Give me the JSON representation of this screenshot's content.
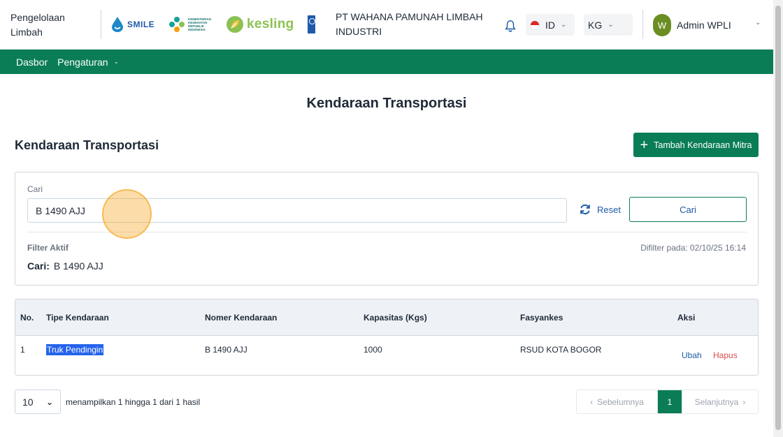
{
  "header": {
    "app_name": "Pengelolaan Limbah",
    "logos": {
      "smile": "SMILE",
      "kemkes": "KEMENTERIAN KESEHATAN REPUBLIK INDONESIA",
      "kesling": "kesling"
    },
    "org_name": "PT WAHANA PAMUNAH LIMBAH INDUSTRI",
    "language": "ID",
    "unit": "KG",
    "user": {
      "initial": "W",
      "name": "Admin WPLI"
    }
  },
  "nav": {
    "items": [
      {
        "label": "Dasbor"
      },
      {
        "label": "Pengaturan"
      }
    ]
  },
  "page": {
    "title": "Kendaraan Transportasi",
    "section_title": "Kendaraan Transportasi",
    "add_button": "Tambah Kendaraan Mitra"
  },
  "filter": {
    "search_label": "Cari",
    "search_value": "B 1490 AJJ",
    "reset_label": "Reset",
    "search_button": "Cari",
    "active_label": "Filter Aktif",
    "filtered_at": "Difilter pada: 02/10/25 16:14",
    "active_key": "Cari:",
    "active_value": "B 1490 AJJ"
  },
  "table": {
    "columns": [
      "No.",
      "Tipe Kendaraan",
      "Nomer Kendaraan",
      "Kapasitas (Kgs)",
      "Fasyankes",
      "Aksi"
    ],
    "rows": [
      {
        "no": "1",
        "type": "Truk Pendingin",
        "plate": "B 1490 AJJ",
        "capacity": "1000",
        "facility": "RSUD KOTA BOGOR",
        "edit": "Ubah",
        "delete": "Hapus"
      }
    ]
  },
  "pagination": {
    "page_size": "10",
    "showing": "menampilkan 1 hingga 1 dari 1 hasil",
    "prev": "Sebelumnya",
    "current": "1",
    "next": "Selanjutnya"
  },
  "colors": {
    "primary": "#0a7d56",
    "link": "#1e5aa8",
    "danger": "#dc4b4b"
  }
}
